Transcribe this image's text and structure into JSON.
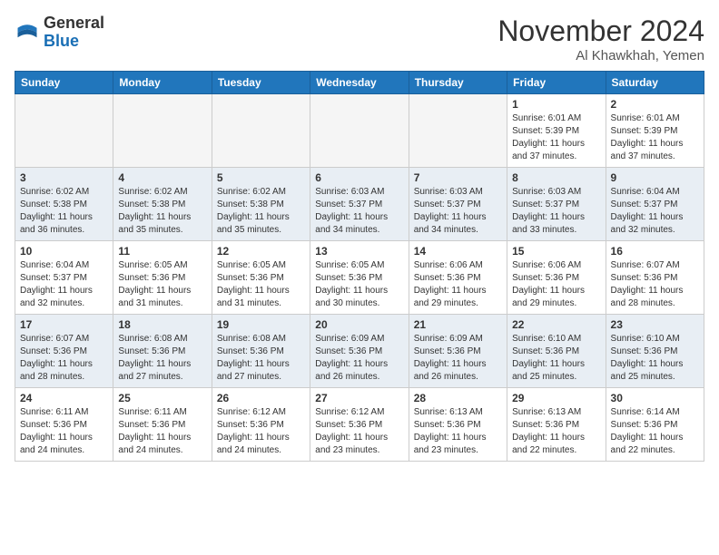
{
  "header": {
    "logo_line1": "General",
    "logo_line2": "Blue",
    "month": "November 2024",
    "location": "Al Khawkhah, Yemen"
  },
  "days_of_week": [
    "Sunday",
    "Monday",
    "Tuesday",
    "Wednesday",
    "Thursday",
    "Friday",
    "Saturday"
  ],
  "weeks": [
    [
      {
        "day": "",
        "info": ""
      },
      {
        "day": "",
        "info": ""
      },
      {
        "day": "",
        "info": ""
      },
      {
        "day": "",
        "info": ""
      },
      {
        "day": "",
        "info": ""
      },
      {
        "day": "1",
        "info": "Sunrise: 6:01 AM\nSunset: 5:39 PM\nDaylight: 11 hours and 37 minutes."
      },
      {
        "day": "2",
        "info": "Sunrise: 6:01 AM\nSunset: 5:39 PM\nDaylight: 11 hours and 37 minutes."
      }
    ],
    [
      {
        "day": "3",
        "info": "Sunrise: 6:02 AM\nSunset: 5:38 PM\nDaylight: 11 hours and 36 minutes."
      },
      {
        "day": "4",
        "info": "Sunrise: 6:02 AM\nSunset: 5:38 PM\nDaylight: 11 hours and 35 minutes."
      },
      {
        "day": "5",
        "info": "Sunrise: 6:02 AM\nSunset: 5:38 PM\nDaylight: 11 hours and 35 minutes."
      },
      {
        "day": "6",
        "info": "Sunrise: 6:03 AM\nSunset: 5:37 PM\nDaylight: 11 hours and 34 minutes."
      },
      {
        "day": "7",
        "info": "Sunrise: 6:03 AM\nSunset: 5:37 PM\nDaylight: 11 hours and 34 minutes."
      },
      {
        "day": "8",
        "info": "Sunrise: 6:03 AM\nSunset: 5:37 PM\nDaylight: 11 hours and 33 minutes."
      },
      {
        "day": "9",
        "info": "Sunrise: 6:04 AM\nSunset: 5:37 PM\nDaylight: 11 hours and 32 minutes."
      }
    ],
    [
      {
        "day": "10",
        "info": "Sunrise: 6:04 AM\nSunset: 5:37 PM\nDaylight: 11 hours and 32 minutes."
      },
      {
        "day": "11",
        "info": "Sunrise: 6:05 AM\nSunset: 5:36 PM\nDaylight: 11 hours and 31 minutes."
      },
      {
        "day": "12",
        "info": "Sunrise: 6:05 AM\nSunset: 5:36 PM\nDaylight: 11 hours and 31 minutes."
      },
      {
        "day": "13",
        "info": "Sunrise: 6:05 AM\nSunset: 5:36 PM\nDaylight: 11 hours and 30 minutes."
      },
      {
        "day": "14",
        "info": "Sunrise: 6:06 AM\nSunset: 5:36 PM\nDaylight: 11 hours and 29 minutes."
      },
      {
        "day": "15",
        "info": "Sunrise: 6:06 AM\nSunset: 5:36 PM\nDaylight: 11 hours and 29 minutes."
      },
      {
        "day": "16",
        "info": "Sunrise: 6:07 AM\nSunset: 5:36 PM\nDaylight: 11 hours and 28 minutes."
      }
    ],
    [
      {
        "day": "17",
        "info": "Sunrise: 6:07 AM\nSunset: 5:36 PM\nDaylight: 11 hours and 28 minutes."
      },
      {
        "day": "18",
        "info": "Sunrise: 6:08 AM\nSunset: 5:36 PM\nDaylight: 11 hours and 27 minutes."
      },
      {
        "day": "19",
        "info": "Sunrise: 6:08 AM\nSunset: 5:36 PM\nDaylight: 11 hours and 27 minutes."
      },
      {
        "day": "20",
        "info": "Sunrise: 6:09 AM\nSunset: 5:36 PM\nDaylight: 11 hours and 26 minutes."
      },
      {
        "day": "21",
        "info": "Sunrise: 6:09 AM\nSunset: 5:36 PM\nDaylight: 11 hours and 26 minutes."
      },
      {
        "day": "22",
        "info": "Sunrise: 6:10 AM\nSunset: 5:36 PM\nDaylight: 11 hours and 25 minutes."
      },
      {
        "day": "23",
        "info": "Sunrise: 6:10 AM\nSunset: 5:36 PM\nDaylight: 11 hours and 25 minutes."
      }
    ],
    [
      {
        "day": "24",
        "info": "Sunrise: 6:11 AM\nSunset: 5:36 PM\nDaylight: 11 hours and 24 minutes."
      },
      {
        "day": "25",
        "info": "Sunrise: 6:11 AM\nSunset: 5:36 PM\nDaylight: 11 hours and 24 minutes."
      },
      {
        "day": "26",
        "info": "Sunrise: 6:12 AM\nSunset: 5:36 PM\nDaylight: 11 hours and 24 minutes."
      },
      {
        "day": "27",
        "info": "Sunrise: 6:12 AM\nSunset: 5:36 PM\nDaylight: 11 hours and 23 minutes."
      },
      {
        "day": "28",
        "info": "Sunrise: 6:13 AM\nSunset: 5:36 PM\nDaylight: 11 hours and 23 minutes."
      },
      {
        "day": "29",
        "info": "Sunrise: 6:13 AM\nSunset: 5:36 PM\nDaylight: 11 hours and 22 minutes."
      },
      {
        "day": "30",
        "info": "Sunrise: 6:14 AM\nSunset: 5:36 PM\nDaylight: 11 hours and 22 minutes."
      }
    ]
  ]
}
